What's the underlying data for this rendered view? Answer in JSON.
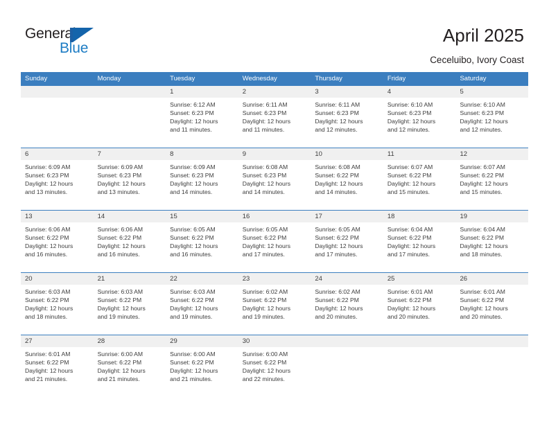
{
  "brand": {
    "name_part1": "General",
    "name_part2": "Blue",
    "logo_icon": "flag-triangle-icon",
    "accent_color": "#1d7cc4",
    "header_color": "#3b7ebf"
  },
  "header": {
    "title": "April 2025",
    "subtitle": "Ceceluibo, Ivory Coast"
  },
  "calendar": {
    "weekdays": [
      "Sunday",
      "Monday",
      "Tuesday",
      "Wednesday",
      "Thursday",
      "Friday",
      "Saturday"
    ],
    "weeks": [
      [
        {
          "day": "",
          "sunrise": "",
          "sunset": "",
          "daylight_line1": "",
          "daylight_line2": "",
          "empty": true
        },
        {
          "day": "",
          "sunrise": "",
          "sunset": "",
          "daylight_line1": "",
          "daylight_line2": "",
          "empty": true
        },
        {
          "day": "1",
          "sunrise": "Sunrise: 6:12 AM",
          "sunset": "Sunset: 6:23 PM",
          "daylight_line1": "Daylight: 12 hours",
          "daylight_line2": "and 11 minutes.",
          "empty": false
        },
        {
          "day": "2",
          "sunrise": "Sunrise: 6:11 AM",
          "sunset": "Sunset: 6:23 PM",
          "daylight_line1": "Daylight: 12 hours",
          "daylight_line2": "and 11 minutes.",
          "empty": false
        },
        {
          "day": "3",
          "sunrise": "Sunrise: 6:11 AM",
          "sunset": "Sunset: 6:23 PM",
          "daylight_line1": "Daylight: 12 hours",
          "daylight_line2": "and 12 minutes.",
          "empty": false
        },
        {
          "day": "4",
          "sunrise": "Sunrise: 6:10 AM",
          "sunset": "Sunset: 6:23 PM",
          "daylight_line1": "Daylight: 12 hours",
          "daylight_line2": "and 12 minutes.",
          "empty": false
        },
        {
          "day": "5",
          "sunrise": "Sunrise: 6:10 AM",
          "sunset": "Sunset: 6:23 PM",
          "daylight_line1": "Daylight: 12 hours",
          "daylight_line2": "and 12 minutes.",
          "empty": false
        }
      ],
      [
        {
          "day": "6",
          "sunrise": "Sunrise: 6:09 AM",
          "sunset": "Sunset: 6:23 PM",
          "daylight_line1": "Daylight: 12 hours",
          "daylight_line2": "and 13 minutes.",
          "empty": false
        },
        {
          "day": "7",
          "sunrise": "Sunrise: 6:09 AM",
          "sunset": "Sunset: 6:23 PM",
          "daylight_line1": "Daylight: 12 hours",
          "daylight_line2": "and 13 minutes.",
          "empty": false
        },
        {
          "day": "8",
          "sunrise": "Sunrise: 6:09 AM",
          "sunset": "Sunset: 6:23 PM",
          "daylight_line1": "Daylight: 12 hours",
          "daylight_line2": "and 14 minutes.",
          "empty": false
        },
        {
          "day": "9",
          "sunrise": "Sunrise: 6:08 AM",
          "sunset": "Sunset: 6:23 PM",
          "daylight_line1": "Daylight: 12 hours",
          "daylight_line2": "and 14 minutes.",
          "empty": false
        },
        {
          "day": "10",
          "sunrise": "Sunrise: 6:08 AM",
          "sunset": "Sunset: 6:22 PM",
          "daylight_line1": "Daylight: 12 hours",
          "daylight_line2": "and 14 minutes.",
          "empty": false
        },
        {
          "day": "11",
          "sunrise": "Sunrise: 6:07 AM",
          "sunset": "Sunset: 6:22 PM",
          "daylight_line1": "Daylight: 12 hours",
          "daylight_line2": "and 15 minutes.",
          "empty": false
        },
        {
          "day": "12",
          "sunrise": "Sunrise: 6:07 AM",
          "sunset": "Sunset: 6:22 PM",
          "daylight_line1": "Daylight: 12 hours",
          "daylight_line2": "and 15 minutes.",
          "empty": false
        }
      ],
      [
        {
          "day": "13",
          "sunrise": "Sunrise: 6:06 AM",
          "sunset": "Sunset: 6:22 PM",
          "daylight_line1": "Daylight: 12 hours",
          "daylight_line2": "and 16 minutes.",
          "empty": false
        },
        {
          "day": "14",
          "sunrise": "Sunrise: 6:06 AM",
          "sunset": "Sunset: 6:22 PM",
          "daylight_line1": "Daylight: 12 hours",
          "daylight_line2": "and 16 minutes.",
          "empty": false
        },
        {
          "day": "15",
          "sunrise": "Sunrise: 6:05 AM",
          "sunset": "Sunset: 6:22 PM",
          "daylight_line1": "Daylight: 12 hours",
          "daylight_line2": "and 16 minutes.",
          "empty": false
        },
        {
          "day": "16",
          "sunrise": "Sunrise: 6:05 AM",
          "sunset": "Sunset: 6:22 PM",
          "daylight_line1": "Daylight: 12 hours",
          "daylight_line2": "and 17 minutes.",
          "empty": false
        },
        {
          "day": "17",
          "sunrise": "Sunrise: 6:05 AM",
          "sunset": "Sunset: 6:22 PM",
          "daylight_line1": "Daylight: 12 hours",
          "daylight_line2": "and 17 minutes.",
          "empty": false
        },
        {
          "day": "18",
          "sunrise": "Sunrise: 6:04 AM",
          "sunset": "Sunset: 6:22 PM",
          "daylight_line1": "Daylight: 12 hours",
          "daylight_line2": "and 17 minutes.",
          "empty": false
        },
        {
          "day": "19",
          "sunrise": "Sunrise: 6:04 AM",
          "sunset": "Sunset: 6:22 PM",
          "daylight_line1": "Daylight: 12 hours",
          "daylight_line2": "and 18 minutes.",
          "empty": false
        }
      ],
      [
        {
          "day": "20",
          "sunrise": "Sunrise: 6:03 AM",
          "sunset": "Sunset: 6:22 PM",
          "daylight_line1": "Daylight: 12 hours",
          "daylight_line2": "and 18 minutes.",
          "empty": false
        },
        {
          "day": "21",
          "sunrise": "Sunrise: 6:03 AM",
          "sunset": "Sunset: 6:22 PM",
          "daylight_line1": "Daylight: 12 hours",
          "daylight_line2": "and 19 minutes.",
          "empty": false
        },
        {
          "day": "22",
          "sunrise": "Sunrise: 6:03 AM",
          "sunset": "Sunset: 6:22 PM",
          "daylight_line1": "Daylight: 12 hours",
          "daylight_line2": "and 19 minutes.",
          "empty": false
        },
        {
          "day": "23",
          "sunrise": "Sunrise: 6:02 AM",
          "sunset": "Sunset: 6:22 PM",
          "daylight_line1": "Daylight: 12 hours",
          "daylight_line2": "and 19 minutes.",
          "empty": false
        },
        {
          "day": "24",
          "sunrise": "Sunrise: 6:02 AM",
          "sunset": "Sunset: 6:22 PM",
          "daylight_line1": "Daylight: 12 hours",
          "daylight_line2": "and 20 minutes.",
          "empty": false
        },
        {
          "day": "25",
          "sunrise": "Sunrise: 6:01 AM",
          "sunset": "Sunset: 6:22 PM",
          "daylight_line1": "Daylight: 12 hours",
          "daylight_line2": "and 20 minutes.",
          "empty": false
        },
        {
          "day": "26",
          "sunrise": "Sunrise: 6:01 AM",
          "sunset": "Sunset: 6:22 PM",
          "daylight_line1": "Daylight: 12 hours",
          "daylight_line2": "and 20 minutes.",
          "empty": false
        }
      ],
      [
        {
          "day": "27",
          "sunrise": "Sunrise: 6:01 AM",
          "sunset": "Sunset: 6:22 PM",
          "daylight_line1": "Daylight: 12 hours",
          "daylight_line2": "and 21 minutes.",
          "empty": false
        },
        {
          "day": "28",
          "sunrise": "Sunrise: 6:00 AM",
          "sunset": "Sunset: 6:22 PM",
          "daylight_line1": "Daylight: 12 hours",
          "daylight_line2": "and 21 minutes.",
          "empty": false
        },
        {
          "day": "29",
          "sunrise": "Sunrise: 6:00 AM",
          "sunset": "Sunset: 6:22 PM",
          "daylight_line1": "Daylight: 12 hours",
          "daylight_line2": "and 21 minutes.",
          "empty": false
        },
        {
          "day": "30",
          "sunrise": "Sunrise: 6:00 AM",
          "sunset": "Sunset: 6:22 PM",
          "daylight_line1": "Daylight: 12 hours",
          "daylight_line2": "and 22 minutes.",
          "empty": false
        },
        {
          "day": "",
          "sunrise": "",
          "sunset": "",
          "daylight_line1": "",
          "daylight_line2": "",
          "empty": true
        },
        {
          "day": "",
          "sunrise": "",
          "sunset": "",
          "daylight_line1": "",
          "daylight_line2": "",
          "empty": true
        },
        {
          "day": "",
          "sunrise": "",
          "sunset": "",
          "daylight_line1": "",
          "daylight_line2": "",
          "empty": true
        }
      ]
    ]
  }
}
